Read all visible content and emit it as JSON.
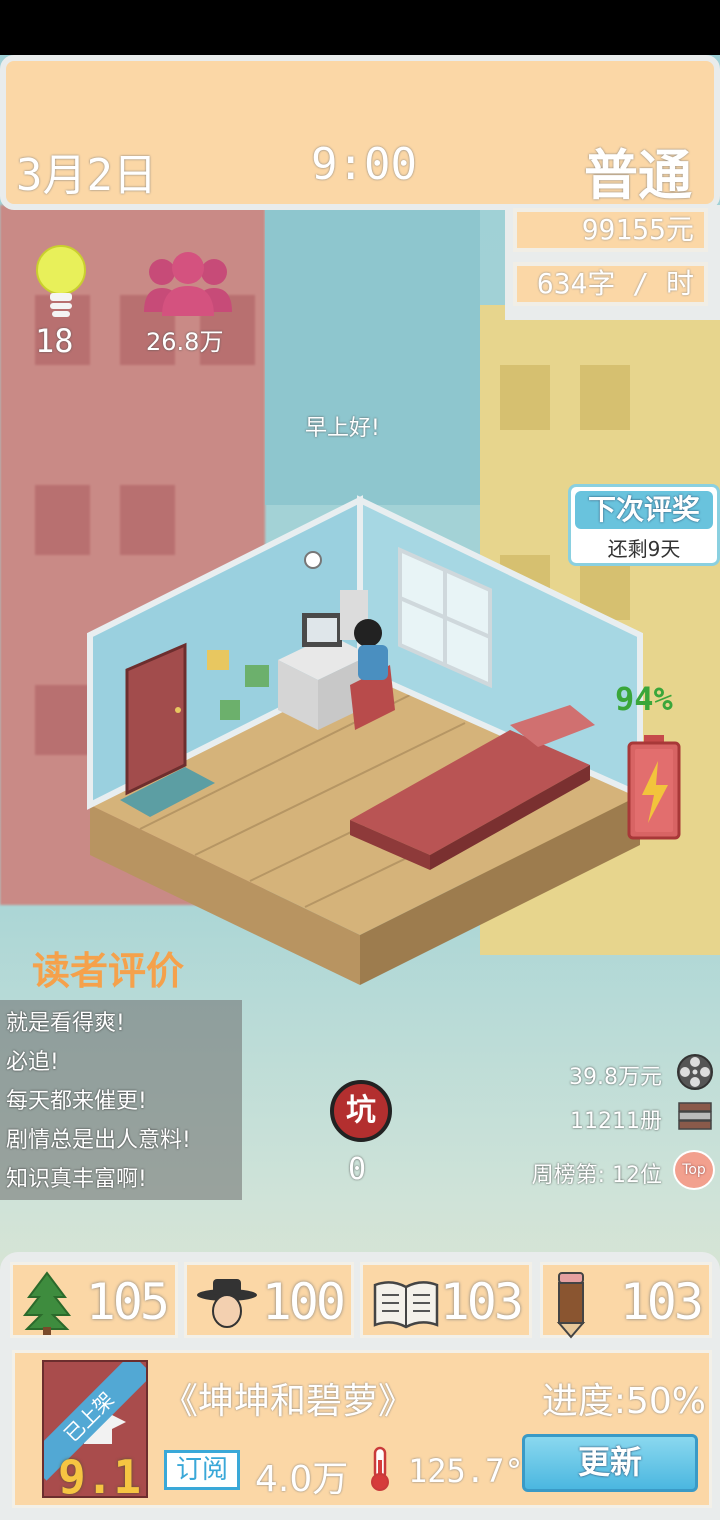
{
  "header": {
    "date": "3月2日",
    "time": "9:00",
    "difficulty": "普通"
  },
  "stats": {
    "money": "99155元",
    "speed": "634字 / 时"
  },
  "inspiration": {
    "value": "18",
    "icon": "lightbulb-icon"
  },
  "fans": {
    "value": "26.8万",
    "icon": "people-icon"
  },
  "greeting": "早上好!",
  "award": {
    "title": "下次评奖",
    "remaining": "还剩9天"
  },
  "energy": {
    "percent": 94,
    "label": "94%",
    "icon": "battery-icon",
    "color": "#3aa63a"
  },
  "reader_reviews": {
    "title": "读者评价",
    "items": [
      "就是看得爽!",
      "必追!",
      "每天都来催更!",
      "剧情总是出人意料!",
      "知识真丰富啊!"
    ]
  },
  "pit": {
    "label": "坑",
    "value": "0"
  },
  "right_stats": {
    "film": "39.8万元",
    "books": "11211册",
    "rank": "周榜第: 12位",
    "rank_badge": "Top"
  },
  "skills": [
    {
      "name": "tree",
      "value": "105"
    },
    {
      "name": "hat-character",
      "value": "100"
    },
    {
      "name": "book",
      "value": "103"
    },
    {
      "name": "pencil",
      "value": "103"
    }
  ],
  "book": {
    "status": "已上架",
    "score": "9.1",
    "title": "《坤坤和碧萝》",
    "progress": "进度:50%",
    "subscribe_label": "订阅",
    "subscribers": "4.0万",
    "heat": "125.7°",
    "update_label": "更新"
  },
  "colors": {
    "accent": "#fbd7a6",
    "button": "#4bb7e0",
    "review_title": "#f5a14b"
  }
}
